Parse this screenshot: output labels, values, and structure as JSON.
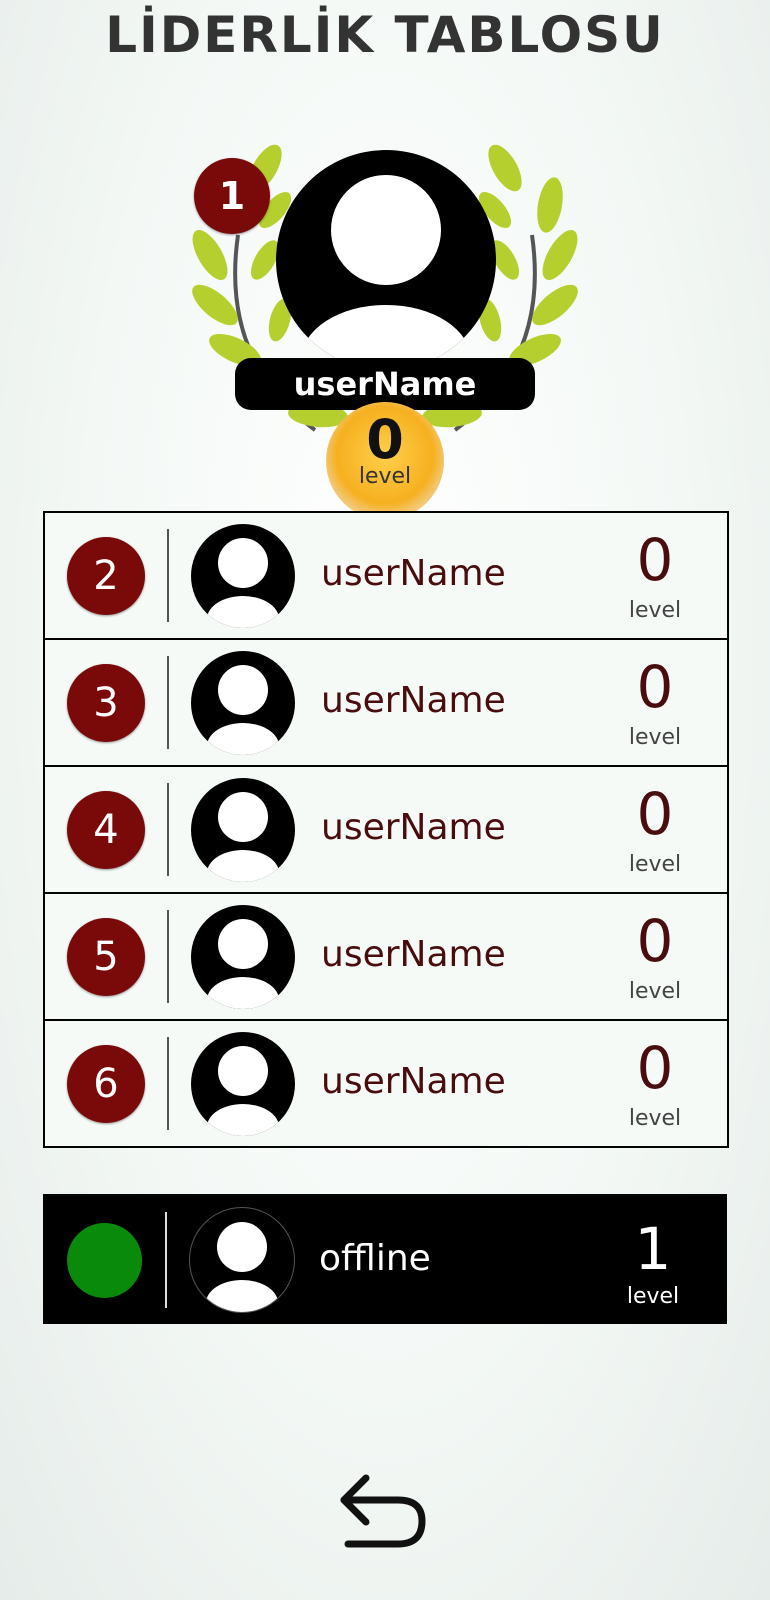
{
  "header": {
    "title": "LİDERLİK TABLOSU"
  },
  "top_player": {
    "rank": "1",
    "name": "userName",
    "level": "0",
    "level_label": "level"
  },
  "leaderboard": [
    {
      "rank": "2",
      "name": "userName",
      "level": "0",
      "level_label": "level"
    },
    {
      "rank": "3",
      "name": "userName",
      "level": "0",
      "level_label": "level"
    },
    {
      "rank": "4",
      "name": "userName",
      "level": "0",
      "level_label": "level"
    },
    {
      "rank": "5",
      "name": "userName",
      "level": "0",
      "level_label": "level"
    },
    {
      "rank": "6",
      "name": "userName",
      "level": "0",
      "level_label": "level"
    }
  ],
  "current_user": {
    "status": "offline",
    "status_color": "#0a8a0a",
    "level": "1",
    "level_label": "level"
  },
  "colors": {
    "rank_badge": "#7a0a0a",
    "name_text": "#4a0d0d",
    "wreath": "#b5cf2e"
  },
  "icons": {
    "back": "back-arrow-icon",
    "avatar": "user-avatar-icon",
    "wreath": "laurel-wreath-icon",
    "coin": "level-coin-icon"
  }
}
